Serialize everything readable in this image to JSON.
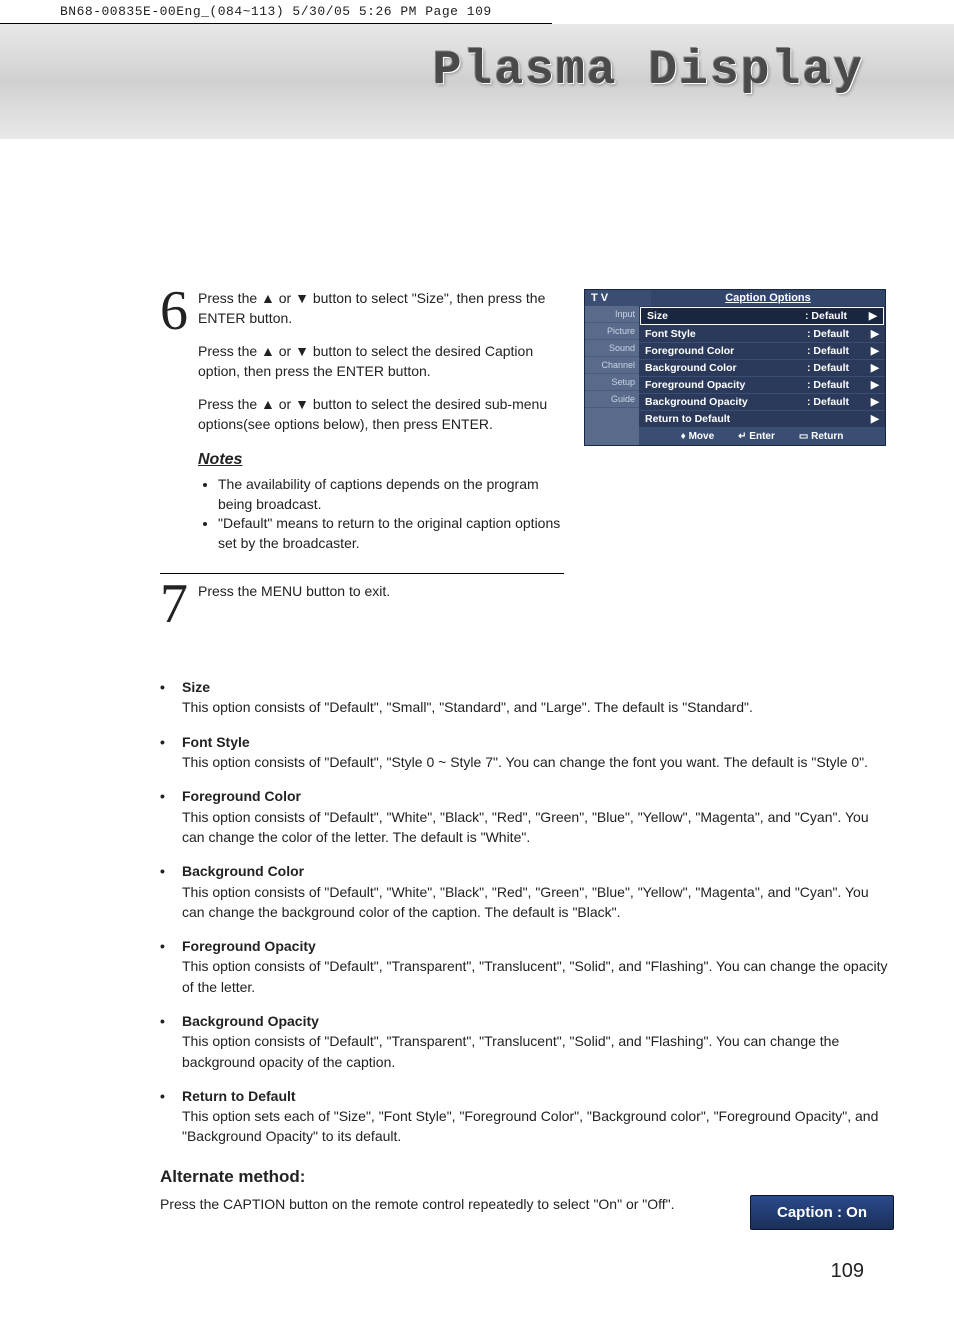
{
  "print_header": "BN68-00835E-00Eng_(084~113)  5/30/05  5:26 PM  Page 109",
  "band_title": "Plasma Display",
  "step6": {
    "num": "6",
    "p1": "Press the ▲ or ▼ button to select \"Size\", then press the ENTER button.",
    "p2": "Press the ▲ or ▼ button to select the desired Caption option, then press the ENTER button.",
    "p3": "Press the ▲ or ▼ button to select the desired sub-menu options(see options below), then press ENTER."
  },
  "notes": {
    "title": "Notes",
    "items": [
      "The availability of captions depends on the program being broadcast.",
      "\"Default\" means to return to the original caption options set by the broadcaster."
    ]
  },
  "step7": {
    "num": "7",
    "p1": "Press the MENU button to exit."
  },
  "osd": {
    "tv": "T V",
    "title": "Caption Options",
    "side": [
      "Input",
      "Picture",
      "Sound",
      "Channel",
      "Setup",
      "Guide"
    ],
    "rows": [
      {
        "label": "Size",
        "val": ": Default",
        "selected": true
      },
      {
        "label": "Font Style",
        "val": ": Default",
        "selected": false
      },
      {
        "label": "Foreground Color",
        "val": ": Default",
        "selected": false
      },
      {
        "label": "Background Color",
        "val": ": Default",
        "selected": false
      },
      {
        "label": "Foreground Opacity",
        "val": ": Default",
        "selected": false
      },
      {
        "label": "Background Opacity",
        "val": ": Default",
        "selected": false
      },
      {
        "label": "Return to Default",
        "val": "",
        "selected": false
      }
    ],
    "footer": {
      "move": "Move",
      "enter": "Enter",
      "ret": "Return"
    }
  },
  "options": [
    {
      "title": "Size",
      "desc": "This option consists of \"Default\", \"Small\", \"Standard\", and \"Large\". The default is \"Standard\"."
    },
    {
      "title": "Font Style",
      "desc": "This option consists of \"Default\", \"Style 0 ~ Style 7\". You can change the font you want. The default is \"Style 0\"."
    },
    {
      "title": "Foreground Color",
      "desc": "This option consists of \"Default\", \"White\", \"Black\", \"Red\", \"Green\", \"Blue\", \"Yellow\", \"Magenta\", and \"Cyan\". You can change the color of the letter. The default is \"White\"."
    },
    {
      "title": "Background Color",
      "desc": "This option consists of \"Default\", \"White\", \"Black\", \"Red\", \"Green\", \"Blue\", \"Yellow\", \"Magenta\", and \"Cyan\". You can change the background color of the caption. The default is \"Black\"."
    },
    {
      "title": "Foreground Opacity",
      "desc": "This option consists of \"Default\", \"Transparent\", \"Translucent\", \"Solid\", and \"Flashing\". You can change the opacity of the letter."
    },
    {
      "title": "Background Opacity",
      "desc": "This option consists of \"Default\", \"Transparent\", \"Translucent\", \"Solid\", and \"Flashing\". You can change the background opacity of the caption."
    },
    {
      "title": "Return to Default",
      "desc": "This option sets each of \"Size\", \"Font Style\", \"Foreground Color\", \"Background color\", \"Foreground Opacity\", and \"Background Opacity\" to its default."
    }
  ],
  "alternate": {
    "title": "Alternate method:",
    "text": "Press the CAPTION button on the remote control repeatedly to select \"On\" or \"Off\".",
    "pill": "Caption : On"
  },
  "page_number": "109"
}
